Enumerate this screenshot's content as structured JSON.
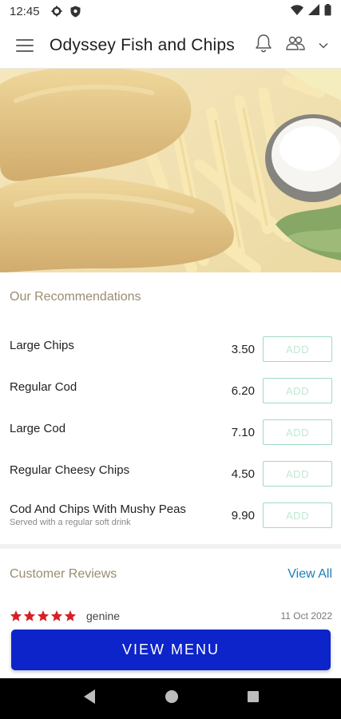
{
  "status_bar": {
    "time": "12:45",
    "icons": [
      "gear-icon",
      "shield-icon",
      "wifi-icon",
      "signal-icon",
      "battery-icon"
    ]
  },
  "app_bar": {
    "title": "Odyssey Fish and Chips",
    "icons": [
      "menu-icon",
      "bell-icon",
      "people-icon",
      "chevron-down-icon"
    ]
  },
  "hero": {
    "alt": "fish-and-chips-photo"
  },
  "recommendations": {
    "heading": "Our Recommendations",
    "add_label": "ADD",
    "items": [
      {
        "name": "Large Chips",
        "price": "3.50",
        "description": ""
      },
      {
        "name": "Regular Cod",
        "price": "6.20",
        "description": ""
      },
      {
        "name": "Large Cod",
        "price": "7.10",
        "description": ""
      },
      {
        "name": "Regular Cheesy Chips",
        "price": "4.50",
        "description": ""
      },
      {
        "name": "Cod And Chips With Mushy Peas",
        "price": "9.90",
        "description": "Served with a regular soft drink"
      }
    ]
  },
  "reviews": {
    "heading": "Customer Reviews",
    "view_all": "View All",
    "first": {
      "rating": 5,
      "author": "genine",
      "date": "11 Oct 2022"
    }
  },
  "cta": {
    "label": "VIEW MENU"
  },
  "colors": {
    "accent_tan": "#9a8d72",
    "add_border": "#9fdcc0",
    "link_blue": "#1a7fb8",
    "cta_blue": "#0c24c9",
    "star_red": "#d81f26"
  }
}
